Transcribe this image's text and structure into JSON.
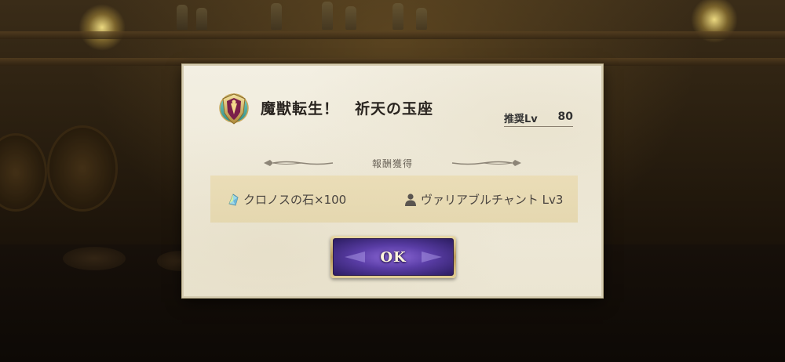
{
  "dialog": {
    "title": "魔獣転生！　祈天の玉座",
    "recommended_label": "推奨Lv",
    "recommended_value": "80",
    "section_title": "報酬獲得",
    "rewards": [
      {
        "icon": "chronos-stone-icon",
        "text": "クロノスの石×100"
      },
      {
        "icon": "person-icon",
        "text": "ヴァリアブルチャント Lv3"
      }
    ],
    "ok_label": "OK"
  },
  "colors": {
    "button_purple": "#5a3da6",
    "button_gold_frame": "#b8995a",
    "panel_bg": "#f0ebdc",
    "reward_band": "#e6d8b0"
  }
}
